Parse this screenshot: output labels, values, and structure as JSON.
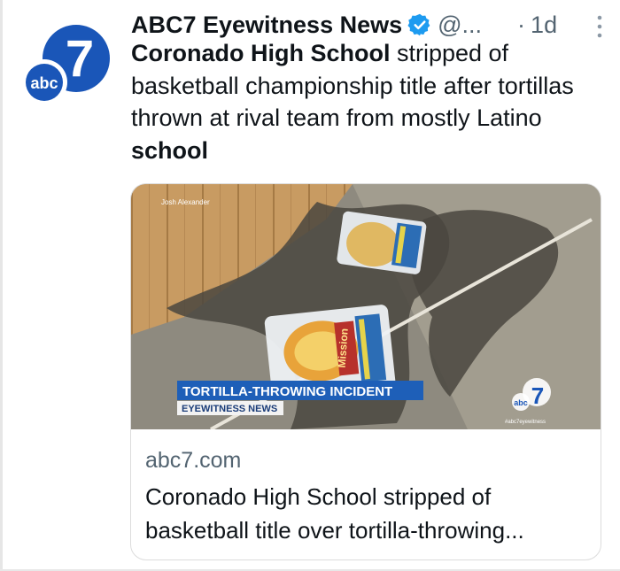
{
  "tweet": {
    "author_name": "ABC7 Eyewitness News",
    "handle": "@...",
    "separator": "·",
    "time": "1d",
    "text_runs": [
      {
        "text": "Coronado High School",
        "bold": true
      },
      {
        "text": " stripped of basketball championship title after tortillas thrown at rival team from mostly Latino ",
        "bold": false
      },
      {
        "text": "school",
        "bold": true
      }
    ]
  },
  "avatar": {
    "logo_text": "abc",
    "logo_number": "7",
    "color": "#1a56b8"
  },
  "card": {
    "domain": "abc7.com",
    "title": "Coronado High School stripped of basketball title over tortilla-throwing...",
    "image": {
      "credit": "Josh Alexander",
      "lower_third_headline": "TORTILLA-THROWING INCIDENT",
      "lower_third_sub": "EYEWITNESS NEWS",
      "package_brand": "Mission",
      "watermark_logo": "abc",
      "watermark_number": "7",
      "watermark_handle": "#abc7eyewitness"
    }
  },
  "colors": {
    "text": "#0f1419",
    "muted": "#536471",
    "verified_blue": "#1d9bf0",
    "brand_blue": "#1a56b8",
    "lower_third_blue": "#1e5fb8"
  },
  "icons": [
    "verified-badge-icon",
    "more-options-icon"
  ]
}
